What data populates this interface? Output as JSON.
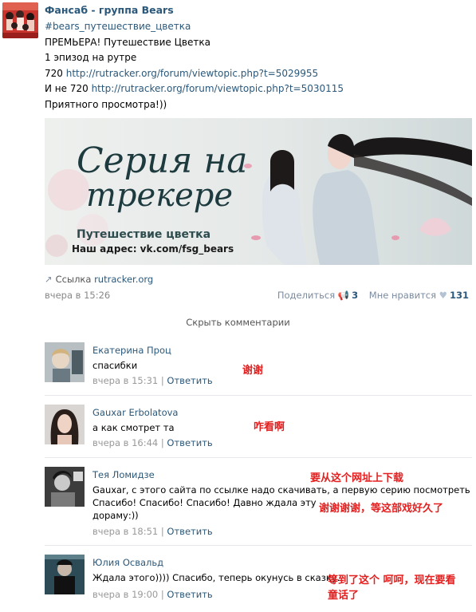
{
  "post": {
    "group_name": "Фансаб - группа Bears",
    "hashtag": "#bears_путешествие_цветка",
    "line1": "ПРЕМЬЕРА! Путешествие Цветка",
    "line2": "1 эпизод на рутре",
    "line3_prefix": "720 ",
    "line3_link": "http://rutracker.org/forum/viewtopic.php?t=5029955",
    "line4_prefix": "И не 720 ",
    "line4_link": "http://rutracker.org/forum/viewtopic.php?t=5030115",
    "line5": "Приятного просмотра!))",
    "banner": {
      "title_line1": "Серия на",
      "title_line2": "трекере",
      "subtitle": "Путешествие цветка",
      "address": "Наш адрес: vk.com/fsg_bears"
    },
    "link_label": "Ссылка",
    "link_domain": "rutracker.org",
    "timestamp": "вчера в 15:26",
    "share_label": "Поделиться",
    "share_count": "3",
    "like_label": "Мне нравится",
    "like_count": "131",
    "hide_comments": "Скрыть комментарии"
  },
  "comments": [
    {
      "name": "Екатерина Проц",
      "text": "спасибки",
      "time": "вчера в 15:31",
      "reply": "Ответить",
      "annotation": "谢谢"
    },
    {
      "name": "Gauxar Erbolatova",
      "text": "а как смотрет та",
      "time": "вчера в 16:44",
      "reply": "Ответить",
      "annotation": "咋看啊"
    },
    {
      "name": "Тея Ломидзе",
      "text_line1": "Gauxar, с этого сайта по ссылке надо скачивать, а первую серию посмотреть",
      "text_line2": "Спасибо! Спасибо! Спасибо! Давно ждала эту",
      "text_line3": "дораму:))",
      "time": "вчера в 18:51",
      "reply": "Ответить",
      "annotation1": "要从这个网址上下载",
      "annotation2": "谢谢谢谢，等这部戏好久了"
    },
    {
      "name": "Юлия Освальд",
      "text": "Ждала этого)))) Спасибо, теперь окунусь в сказку.",
      "time": "вчера в 19:00",
      "reply": "Ответить",
      "annotation_line1": "等到了这个 呵呵，现在要看",
      "annotation_line2": "童话了"
    }
  ],
  "separator": "|",
  "colors": {
    "link": "#2b587a",
    "annotation": "#e32020",
    "meta": "#999999"
  }
}
